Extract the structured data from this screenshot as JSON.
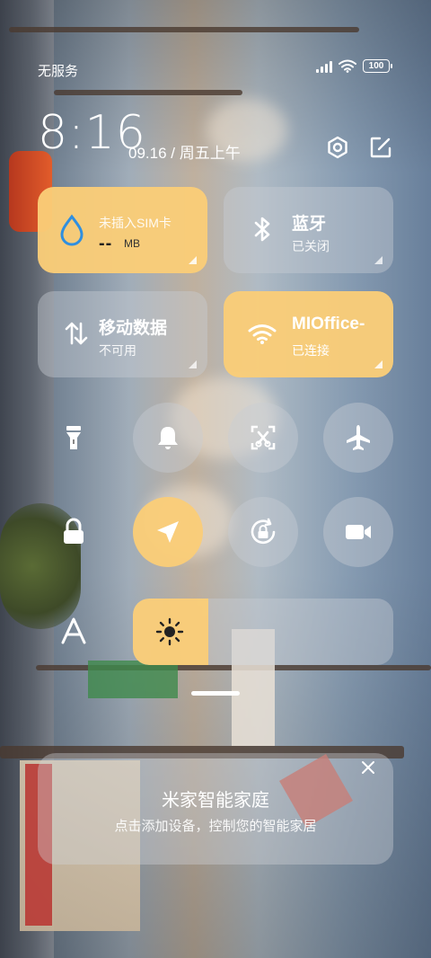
{
  "status_bar": {
    "carrier": "无服务",
    "battery": "100",
    "icons": [
      "signal-icon",
      "wifi-icon",
      "battery-icon"
    ]
  },
  "header": {
    "time": "8:16",
    "date": "09.16 / 周五上午",
    "icons": [
      "settings-icon",
      "edit-icon"
    ]
  },
  "tiles": {
    "sim": {
      "title": "未插入SIM卡",
      "value": "--",
      "unit": "MB",
      "icon": "water-drop-icon",
      "active": true
    },
    "bluetooth": {
      "title": "蓝牙",
      "status": "已关闭",
      "icon": "bluetooth-icon",
      "active": false
    },
    "mobile_data": {
      "title": "移动数据",
      "status": "不可用",
      "icon": "data-arrows-icon",
      "active": false
    },
    "wifi": {
      "title": "MIOffice-",
      "status": "已连接",
      "icon": "wifi-icon",
      "active": true
    }
  },
  "toggles": [
    {
      "name": "flashlight",
      "icon": "flashlight-icon",
      "active": false
    },
    {
      "name": "ring",
      "icon": "bell-icon",
      "active": false
    },
    {
      "name": "screenshot",
      "icon": "screenshot-icon",
      "active": false
    },
    {
      "name": "airplane",
      "icon": "airplane-icon",
      "active": false
    },
    {
      "name": "lock",
      "icon": "lock-icon",
      "active": false
    },
    {
      "name": "location",
      "icon": "location-arrow-icon",
      "active": true
    },
    {
      "name": "rotation-lock",
      "icon": "rotation-lock-icon",
      "active": false
    },
    {
      "name": "screen-record",
      "icon": "video-camera-icon",
      "active": false
    },
    {
      "name": "font",
      "icon": "font-icon",
      "active": false
    }
  ],
  "brightness": {
    "level": 0.29,
    "icon": "sun-icon"
  },
  "smart_home": {
    "title": "米家智能家庭",
    "subtitle": "点击添加设备，控制您的智能家居",
    "close_icon": "close-icon"
  },
  "colors": {
    "active": "#FACD78",
    "inactive": "rgba(200,205,212,0.42)",
    "sim_value": "#1F1F1F"
  }
}
